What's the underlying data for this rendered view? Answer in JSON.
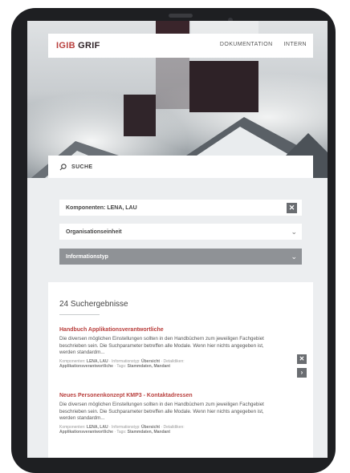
{
  "header": {
    "logo_prefix": "IGIB",
    "logo_suffix": "GRIF",
    "nav": [
      "DOKUMENTATION",
      "INTERN"
    ]
  },
  "search": {
    "label": "SUCHE"
  },
  "filters": [
    {
      "label": "Komponenten: LENA, LAU",
      "control": "close-icon"
    },
    {
      "label": "Organisationseinheit",
      "control": "chevron-down-icon"
    },
    {
      "label": "Informationstyp",
      "control": "chevron-down-icon"
    }
  ],
  "results": {
    "count_label": "24 Suchergebnisse",
    "items": [
      {
        "title": "Handbuch Applikationsverantwortliche",
        "desc": "Die diversen möglichen Einstellungen sollten in den Handbüchern zum jeweiligen Fachgebiet beschrieben sein. Die Suchparameter betreffen alle Modale. Wenn hier nichts angegeben ist, werden standardm...",
        "meta_prefix": "Komponenten:",
        "meta_components": "LENA, LAU",
        "meta_type_prefix": " · Informationstyp:",
        "meta_type": "Übersicht",
        "meta_details_prefix": " · Detaildiken:",
        "meta_details": "Applikationsverantwortliche",
        "meta_tags_prefix": " · Tags:",
        "meta_tags": "Stammdaten, Mandant"
      },
      {
        "title": "Neues Personenkonzept KMP3 - Kontaktadressen",
        "desc": "Die diversen möglichen Einstellungen sollten in den Handbüchern zum jeweiligen Fachgebiet beschrieben sein. Die Suchparameter betreffen alle Modale. Wenn hier nichts angegeben ist, werden standardm...",
        "meta_prefix": "Komponenten:",
        "meta_components": "LENA, LAU",
        "meta_type_prefix": " · Informationstyp:",
        "meta_type": "Übersicht",
        "meta_details_prefix": " · Detaildiken:",
        "meta_details": "Applikationsverantwortliche",
        "meta_tags_prefix": " · Tags:",
        "meta_tags": "Stammdaten, Mandant"
      }
    ]
  },
  "colors": {
    "accent": "#b9403e",
    "dark_square": "#2e2227",
    "active_filter": "#8f9296"
  }
}
